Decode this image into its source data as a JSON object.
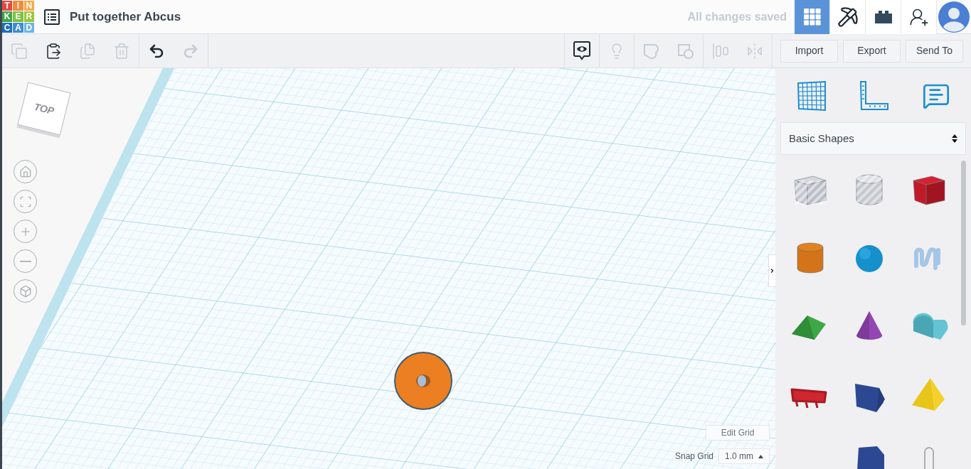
{
  "logo": [
    {
      "letter": "T",
      "color": "#e8483c"
    },
    {
      "letter": "I",
      "color": "#f58a3d"
    },
    {
      "letter": "N",
      "color": "#f7a947"
    },
    {
      "letter": "K",
      "color": "#40a54a"
    },
    {
      "letter": "E",
      "color": "#7cc142"
    },
    {
      "letter": "R",
      "color": "#9bc53d"
    },
    {
      "letter": "C",
      "color": "#1f6fb8"
    },
    {
      "letter": "A",
      "color": "#3d8fd1"
    },
    {
      "letter": "D",
      "color": "#6cb4e4"
    }
  ],
  "title": "Put together Abcus",
  "save_status": "All changes saved",
  "views": [
    {
      "kind": "grid",
      "selected": true
    },
    {
      "kind": "pickaxe",
      "selected": false
    },
    {
      "kind": "brick",
      "selected": false
    }
  ],
  "toolbar": {
    "left_groups": [
      [
        {
          "kind": "copy",
          "disabled": true
        },
        {
          "kind": "paste",
          "disabled": false
        },
        {
          "kind": "duplicate",
          "disabled": true
        },
        {
          "kind": "delete",
          "disabled": true
        }
      ],
      [
        {
          "kind": "undo",
          "disabled": false
        },
        {
          "kind": "redo",
          "disabled": true
        }
      ]
    ],
    "right_groups": [
      [
        {
          "kind": "notes",
          "disabled": false
        }
      ],
      [
        {
          "kind": "bulb",
          "disabled": true
        }
      ],
      [
        {
          "kind": "group",
          "disabled": true
        },
        {
          "kind": "ungroup",
          "disabled": true
        }
      ],
      [
        {
          "kind": "align",
          "disabled": true
        },
        {
          "kind": "mirror",
          "disabled": true
        }
      ]
    ],
    "buttons": [
      "Import",
      "Export",
      "Send To"
    ]
  },
  "view_cube": {
    "label": "TOP"
  },
  "nav_buttons": [
    {
      "kind": "home"
    },
    {
      "kind": "fit"
    },
    {
      "kind": "zoom-in"
    },
    {
      "kind": "zoom-out"
    },
    {
      "kind": "ortho"
    }
  ],
  "grid": {
    "edit_button": "Edit Grid",
    "snap_label": "Snap Grid",
    "snap_value": "1.0 mm"
  },
  "panel": {
    "tools": [
      {
        "kind": "workplane"
      },
      {
        "kind": "ruler"
      },
      {
        "kind": "notes"
      }
    ],
    "library": "Basic Shapes",
    "shape_rows": [
      [
        {
          "kind": "box-hole"
        },
        {
          "kind": "cylinder-hole"
        },
        {
          "kind": "box"
        }
      ],
      [
        {
          "kind": "cylinder"
        },
        {
          "kind": "sphere"
        },
        {
          "kind": "scribble"
        }
      ],
      [
        {
          "kind": "roof"
        },
        {
          "kind": "cone"
        },
        {
          "kind": "round-roof"
        }
      ],
      [
        {
          "kind": "text"
        },
        {
          "kind": "polygon"
        },
        {
          "kind": "pyramid"
        }
      ],
      [
        {
          "kind": "hexagon"
        },
        {
          "kind": "paraboloid"
        }
      ]
    ]
  }
}
